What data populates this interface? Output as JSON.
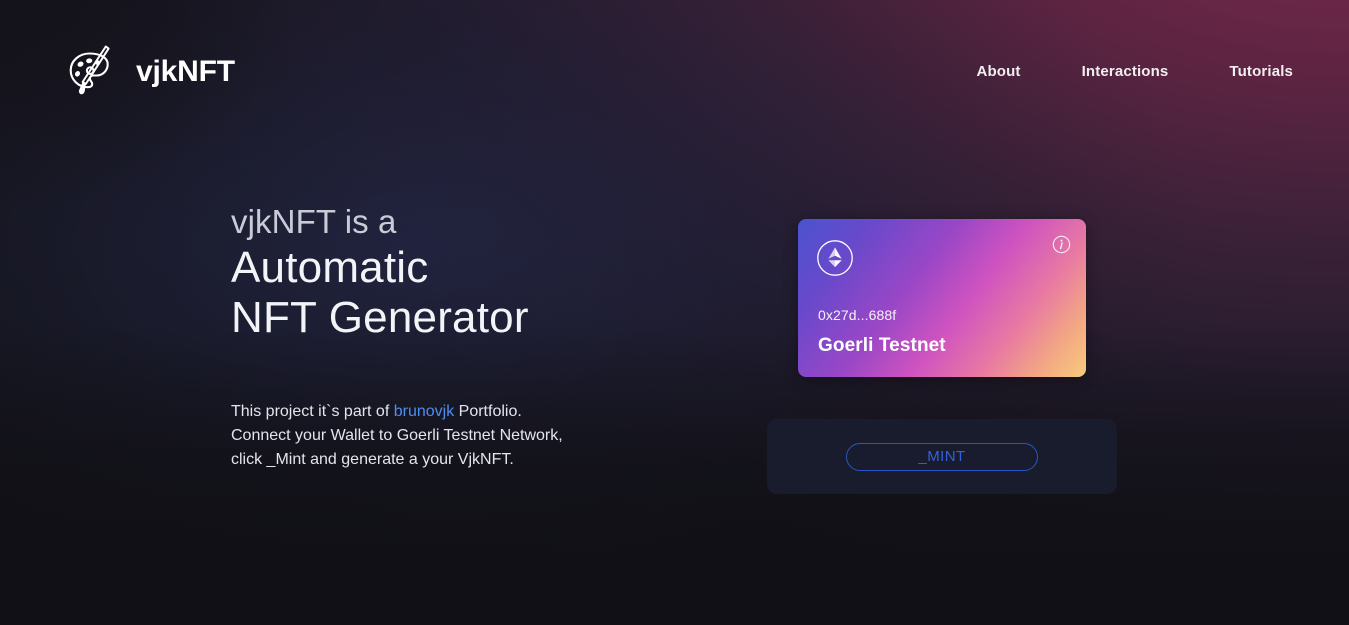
{
  "brand": {
    "name": "vjkNFT",
    "logo_icon": "palette-paintbrush-icon"
  },
  "nav": {
    "items": [
      {
        "label": "About"
      },
      {
        "label": "Interactions"
      },
      {
        "label": "Tutorials"
      }
    ]
  },
  "hero": {
    "line_small": "vjkNFT is a",
    "line_big_1": "Automatic",
    "line_big_2": "NFT Generator",
    "body": {
      "part1": "This project it`s part of ",
      "link": "brunovjk",
      "part2": " Portfolio.",
      "line2": "Connect your Wallet to Goerli Testnet Network,",
      "line3": "click _Mint and generate a your VjkNFT."
    }
  },
  "wallet_card": {
    "chain_icon": "ethereum-icon",
    "info_icon": "info-circle-icon",
    "address": "0x27d...688f",
    "network": "Goerli Testnet",
    "gradient_start": "#4b53cf",
    "gradient_mid": "#cf53c0",
    "gradient_end": "#f8cb7c"
  },
  "mint": {
    "button_label": "_MINT",
    "accent_color": "#3461d8",
    "panel_color": "#191c2c"
  },
  "theme": {
    "background_dark": "#131318",
    "background_wine": "#73244a",
    "link_color": "#4f8df0"
  }
}
